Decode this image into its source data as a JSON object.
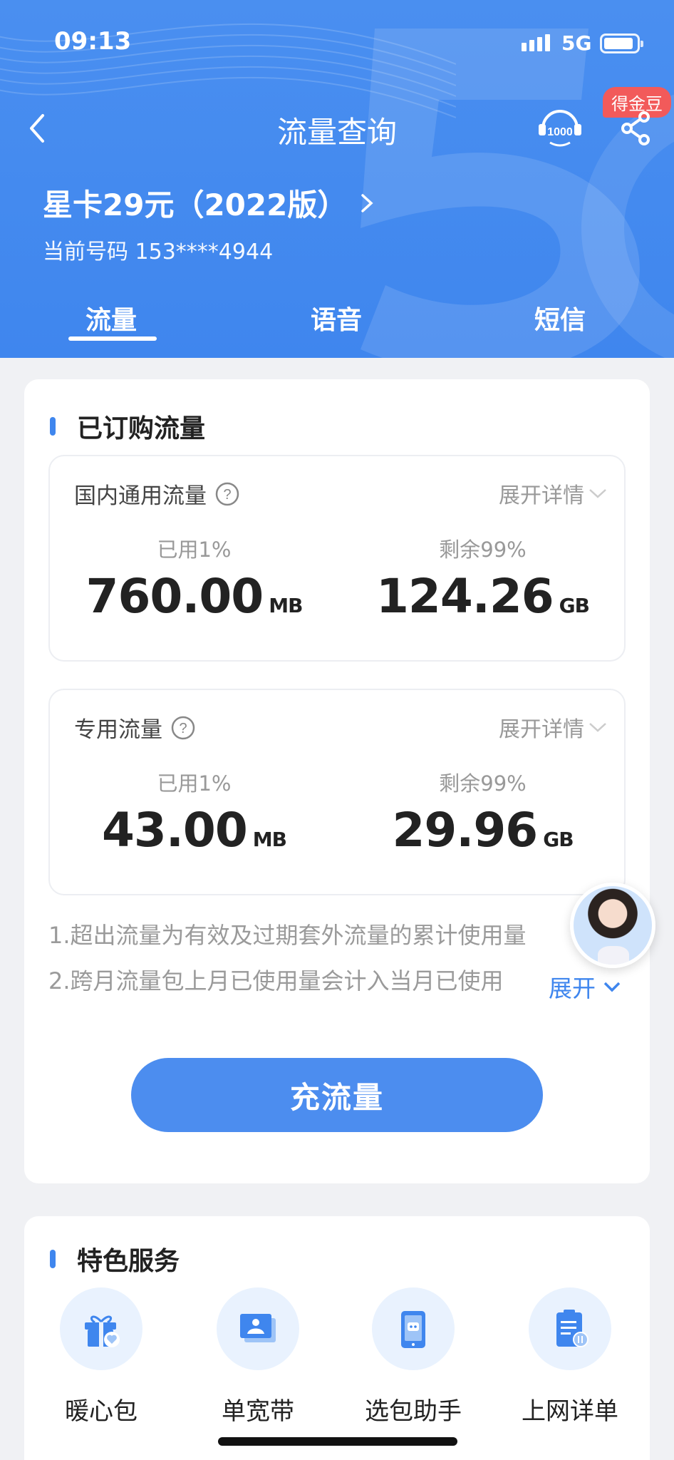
{
  "status": {
    "time": "09:13",
    "network": "5G"
  },
  "nav": {
    "title": "流量查询",
    "badge": "得金豆"
  },
  "plan": {
    "name": "星卡29元（2022版）",
    "phone_label": "当前号码",
    "phone": "153****4944"
  },
  "tabs": [
    {
      "label": "流量"
    },
    {
      "label": "语音"
    },
    {
      "label": "短信"
    }
  ],
  "purchased": {
    "title": "已订购流量",
    "boxes": [
      {
        "title": "国内通用流量",
        "expand": "展开详情",
        "used_label": "已用1%",
        "used_value": "760.00",
        "used_unit": "MB",
        "remain_label": "剩余99%",
        "remain_value": "124.26",
        "remain_unit": "GB"
      },
      {
        "title": "专用流量",
        "expand": "展开详情",
        "used_label": "已用1%",
        "used_value": "43.00",
        "used_unit": "MB",
        "remain_label": "剩余99%",
        "remain_value": "29.96",
        "remain_unit": "GB"
      }
    ],
    "notes": [
      "1.超出流量为有效及过期套外流量的累计使用量",
      "2.跨月流量包上月已使用量会计入当月已使用"
    ],
    "more": "展开",
    "recharge": "充流量"
  },
  "services": {
    "title": "特色服务",
    "items": [
      {
        "label": "暖心包",
        "icon": "gift-icon"
      },
      {
        "label": "单宽带",
        "icon": "broadband-icon"
      },
      {
        "label": "选包助手",
        "icon": "robot-phone-icon"
      },
      {
        "label": "上网详单",
        "icon": "clipboard-icon"
      }
    ]
  },
  "colors": {
    "primary": "#3f86ee",
    "badge": "#f25a5a",
    "bg": "#f0f1f4"
  }
}
